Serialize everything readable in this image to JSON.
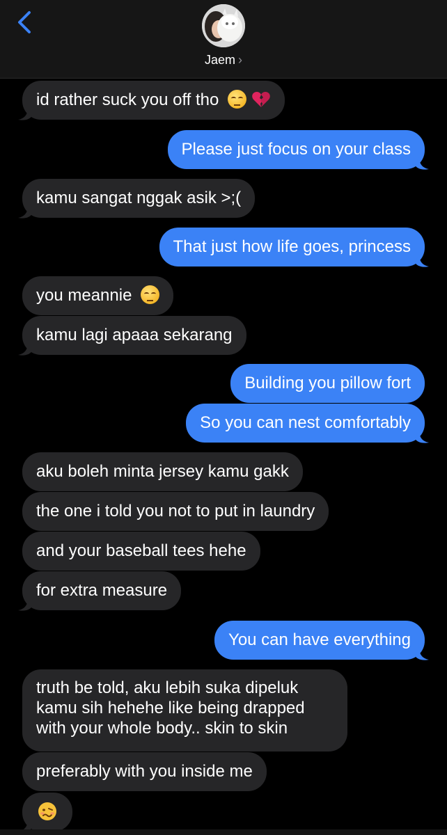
{
  "header": {
    "contact_name": "Jaem",
    "chevron": "›",
    "back_icon": "chevron-left-icon"
  },
  "colors": {
    "incoming_bubble": "#262628",
    "outgoing_bubble": "#3b82f6",
    "header_bg": "#161616",
    "back_accent": "#3b82f6"
  },
  "messages": [
    {
      "dir": "in",
      "text": "id rather suck you off tho",
      "emoji": [
        "pensive-face-icon",
        "broken-heart-icon"
      ]
    },
    {
      "dir": "out",
      "text": "Please just focus on your class"
    },
    {
      "dir": "in",
      "text": "kamu sangat nggak asik >;("
    },
    {
      "dir": "out",
      "text": "That just how life goes, princess"
    },
    {
      "dir": "in",
      "text": "you meannie",
      "emoji": [
        "pensive-face-icon"
      ]
    },
    {
      "dir": "in",
      "text": "kamu lagi apaaa sekarang"
    },
    {
      "dir": "out",
      "text": "Building you pillow fort"
    },
    {
      "dir": "out",
      "text": "So you can nest comfortably"
    },
    {
      "dir": "in",
      "text": "aku boleh minta jersey kamu gakk"
    },
    {
      "dir": "in",
      "text": "the one i told you not to put in laundry"
    },
    {
      "dir": "in",
      "text": "and your baseball tees hehe"
    },
    {
      "dir": "in",
      "text": "for extra measure"
    },
    {
      "dir": "out",
      "text": "You can have everything"
    },
    {
      "dir": "in",
      "lines": [
        "truth be told, aku lebih suka dipeluk",
        "kamu sih hehehe like being drapped",
        "with your whole body.. skin to skin"
      ]
    },
    {
      "dir": "in",
      "text": "preferably with you inside me"
    },
    {
      "dir": "in",
      "emoji": [
        "woozy-face-icon"
      ]
    }
  ]
}
